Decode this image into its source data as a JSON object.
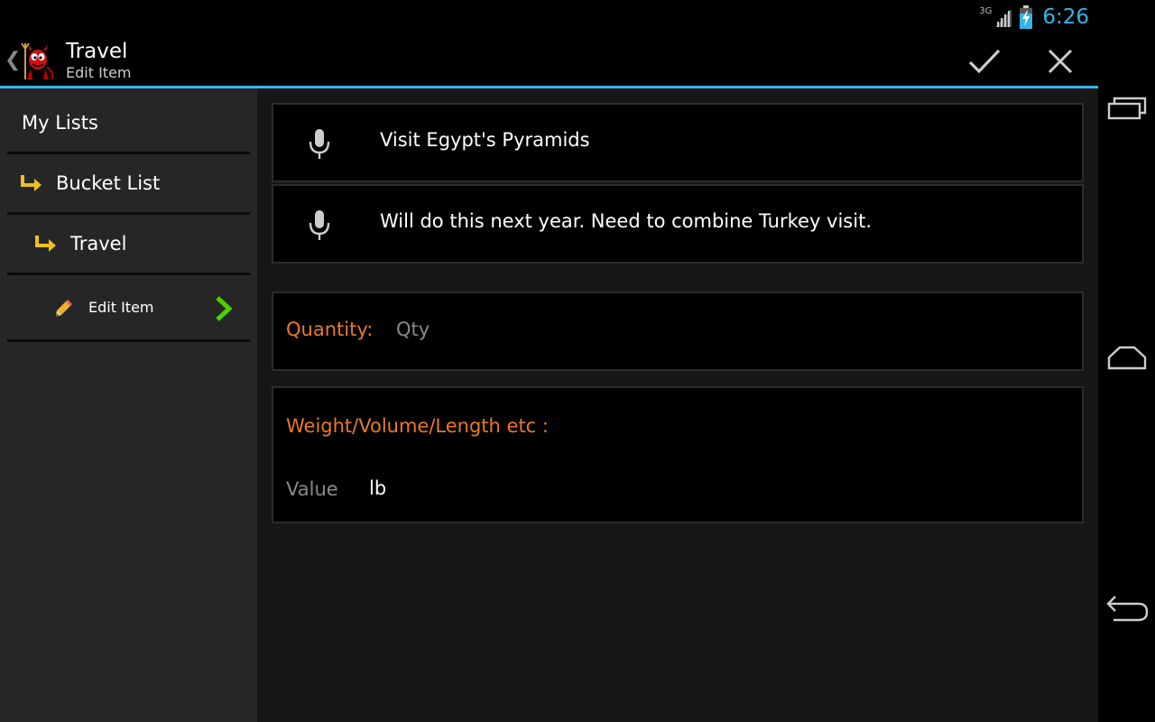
{
  "status_bar": {
    "network_type": "3G",
    "time": "6:26",
    "clock_color": "#33b5e5"
  },
  "action_bar": {
    "title": "Travel",
    "subtitle": "Edit Item",
    "accent_color": "#33b5e5",
    "icons": {
      "up": "chevron-left-icon",
      "logo": "devil-mascot-logo",
      "confirm": "checkmark-icon",
      "cancel": "close-icon"
    }
  },
  "sidebar": {
    "items": [
      {
        "label": "My Lists",
        "icon": ""
      },
      {
        "label": "Bucket List",
        "icon": "subitem-arrow-icon"
      },
      {
        "label": "Travel",
        "icon": "subitem-arrow-icon"
      },
      {
        "label": "Edit Item",
        "icon": "pencil-icon",
        "trailing_icon": "chevron-right-icon"
      }
    ],
    "subitem_arrow_color": "#f0c020",
    "chevron_color": "#4cd000"
  },
  "form": {
    "item_name": "Visit Egypt's Pyramids",
    "item_note": "Will do this next year. Need to combine Turkey visit.",
    "quantity_label": "Quantity:",
    "quantity_placeholder": "Qty",
    "weight_label": "Weight/Volume/Length etc :",
    "value_placeholder": "Value",
    "unit": "lb",
    "label_color": "#e87a26"
  },
  "nav_bar": {
    "icons": [
      "recent-apps-icon",
      "home-icon",
      "back-icon"
    ]
  }
}
